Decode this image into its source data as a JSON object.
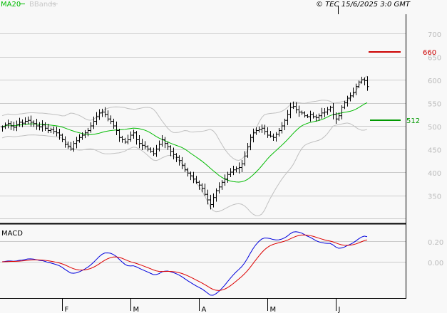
{
  "header": {
    "legend_ma": "MA20",
    "legend_bbands": "BBands",
    "copyright": "© TEC 15/6/2025 3:0 GMT"
  },
  "colors": {
    "background": "#f8f8f8",
    "grid": "#cccccc",
    "ma": "#00bb00",
    "bbands": "#c0c0c0",
    "bars": "#000000",
    "macd": "#0000dd",
    "signal": "#dd0000",
    "resistance": "#cc0000",
    "support": "#009900",
    "axis_label": "#bbbbbb"
  },
  "chart_data": [
    {
      "type": "ohlc",
      "title": "",
      "ylim": [
        320,
        720
      ],
      "y_ticks": [
        "700",
        "650",
        "600",
        "550",
        "500",
        "450",
        "400",
        "350"
      ],
      "y_tick_values": [
        700,
        650,
        600,
        550,
        500,
        450,
        400,
        350
      ],
      "x_month_labels": [
        {
          "label": "F",
          "bar": 21
        },
        {
          "label": "M",
          "bar": 45
        },
        {
          "label": "A",
          "bar": 69
        },
        {
          "label": "M",
          "bar": 93
        },
        {
          "label": "J",
          "bar": 117
        }
      ],
      "closes": [
        498,
        502,
        505,
        500,
        497,
        503,
        508,
        506,
        510,
        512,
        508,
        505,
        500,
        498,
        502,
        495,
        490,
        492,
        488,
        485,
        480,
        470,
        460,
        455,
        450,
        462,
        468,
        475,
        480,
        485,
        490,
        500,
        510,
        520,
        528,
        530,
        525,
        515,
        510,
        500,
        490,
        475,
        470,
        465,
        470,
        480,
        485,
        470,
        462,
        458,
        455,
        450,
        445,
        440,
        450,
        460,
        470,
        462,
        455,
        445,
        438,
        432,
        425,
        415,
        405,
        398,
        392,
        385,
        378,
        372,
        365,
        352,
        340,
        330,
        345,
        360,
        368,
        378,
        385,
        395,
        400,
        405,
        408,
        410,
        418,
        435,
        455,
        475,
        485,
        490,
        492,
        495,
        488,
        480,
        478,
        475,
        482,
        490,
        500,
        512,
        525,
        540,
        542,
        535,
        530,
        528,
        522,
        520,
        525,
        520,
        518,
        522,
        528,
        530,
        535,
        540,
        525,
        515,
        522,
        540,
        550,
        560,
        565,
        572,
        585,
        595,
        600,
        598,
        585
      ],
      "indicators": [
        "MA20",
        "BBands(20,2)"
      ],
      "levels": [
        {
          "name": "resistance",
          "value": 660,
          "label": "660"
        },
        {
          "name": "support",
          "value": 512,
          "label": "512"
        }
      ]
    },
    {
      "type": "line",
      "title": "MACD",
      "y_ticks": [
        "0.20",
        "0.00"
      ],
      "y_tick_values": [
        0.2,
        0.0
      ],
      "series": [
        {
          "name": "MACD",
          "computed_from": "closes"
        },
        {
          "name": "Signal",
          "computed_from": "MACD"
        }
      ]
    }
  ]
}
